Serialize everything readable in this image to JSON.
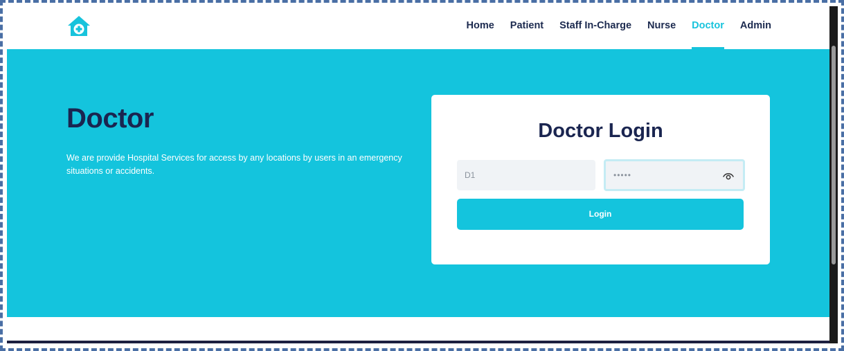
{
  "brand": {
    "logo_icon": "house-medical-cross-icon",
    "accent": "#17c3dc",
    "hero_bg": "#14c4dd",
    "heading_color": "#1a2550"
  },
  "nav": {
    "items": [
      {
        "label": "Home"
      },
      {
        "label": "Patient"
      },
      {
        "label": "Staff In-Charge"
      },
      {
        "label": "Nurse"
      },
      {
        "label": "Doctor",
        "active": true
      },
      {
        "label": "Admin"
      }
    ]
  },
  "hero": {
    "title": "Doctor",
    "description": "We are provide Hospital Services for access by any locations by users in an emergency situations or accidents."
  },
  "login": {
    "title": "Doctor Login",
    "username_value": "D1",
    "password_value": "•••••",
    "eye_icon": "eye-icon",
    "button_label": "Login"
  }
}
